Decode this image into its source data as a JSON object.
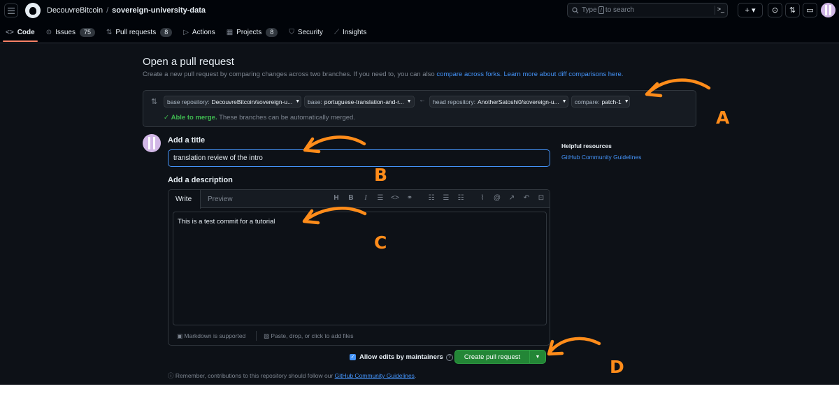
{
  "header": {
    "owner": "DecouvreBitcoin",
    "separator": "/",
    "repo": "sovereign-university-data",
    "search_prefix": "Type",
    "search_slash": "/",
    "search_suffix": "to search",
    "plus_label": "+ ▾"
  },
  "tabs": [
    {
      "label": "Code",
      "icon": "code-icon"
    },
    {
      "label": "Issues",
      "count": "75",
      "icon": "issue-icon"
    },
    {
      "label": "Pull requests",
      "count": "8",
      "icon": "pull-request-icon"
    },
    {
      "label": "Actions",
      "icon": "play-icon"
    },
    {
      "label": "Projects",
      "count": "8",
      "icon": "table-icon"
    },
    {
      "label": "Security",
      "icon": "shield-icon"
    },
    {
      "label": "Insights",
      "icon": "graph-icon"
    }
  ],
  "page": {
    "title": "Open a pull request",
    "subtitle": "Create a new pull request by comparing changes across two branches. If you need to, you can also",
    "compare_forks_link": "compare across forks.",
    "learn_more_link": "Learn more about diff comparisons here."
  },
  "compare": {
    "base_repo_label": "base repository:",
    "base_repo_value": "DecouvreBitcoin/sovereign-u...",
    "base_label": "base:",
    "base_value": "portuguese-translation-and-r...",
    "head_repo_label": "head repository:",
    "head_repo_value": "AnotherSatoshi0/sovereign-u...",
    "compare_label": "compare:",
    "compare_value": "patch-1",
    "merge_status": "Able to merge.",
    "merge_message": "These branches can be automatically merged."
  },
  "form": {
    "title_label": "Add a title",
    "title_value": "translation review of the intro",
    "description_label": "Add a description",
    "write_tab": "Write",
    "preview_tab": "Preview",
    "description_value": "This is a test commit for a tutorial",
    "markdown_note": "Markdown is supported",
    "paste_note": "Paste, drop, or click to add files",
    "allow_edits_label": "Allow edits by maintainers",
    "allow_edits_checked": true,
    "create_button": "Create pull request"
  },
  "sidebar": {
    "heading": "Helpful resources",
    "link": "GitHub Community Guidelines"
  },
  "footer": {
    "remember_text": "Remember, contributions to this repository should follow our",
    "remember_link": "GitHub Community Guidelines",
    "remember_end": "."
  },
  "annotations": {
    "letters": [
      "A",
      "B",
      "C",
      "D"
    ],
    "color": "#ff8c1a"
  }
}
